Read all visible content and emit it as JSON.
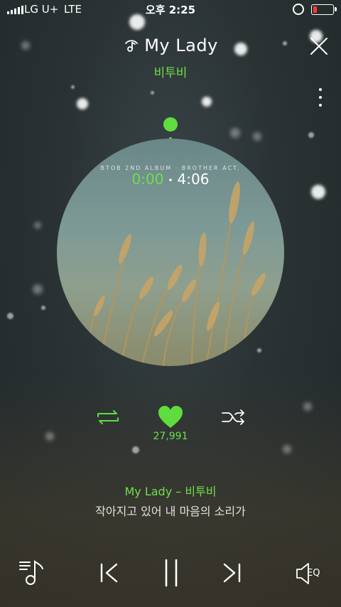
{
  "status_bar": {
    "carrier": "LG U+",
    "network": "LTE",
    "time": "오후 2:25",
    "battery_color": "#ff3b30"
  },
  "header": {
    "title": "My Lady",
    "artist": "비투비",
    "title_icon": "music-note-icon",
    "close_icon": "close-icon",
    "more_icon": "more-vertical-icon"
  },
  "album": {
    "caption": "BTOB 2ND ALBUM · BROTHER ACT.",
    "current_time": "0:00",
    "separator": "•",
    "total_time": "4:06"
  },
  "actions": {
    "repeat_icon": "repeat-icon",
    "heart_icon": "heart-icon",
    "like_count": "27,991",
    "shuffle_icon": "shuffle-icon"
  },
  "lyrics": {
    "now_playing": "My Lady – 비투비",
    "current_line": "작아지고 있어 내 마음의 소리가"
  },
  "controls": {
    "playlist_icon": "playlist-icon",
    "prev_icon": "previous-icon",
    "pause_icon": "pause-icon",
    "next_icon": "next-icon",
    "eq_label": "EQ"
  },
  "colors": {
    "accent": "#5fdc3e"
  }
}
